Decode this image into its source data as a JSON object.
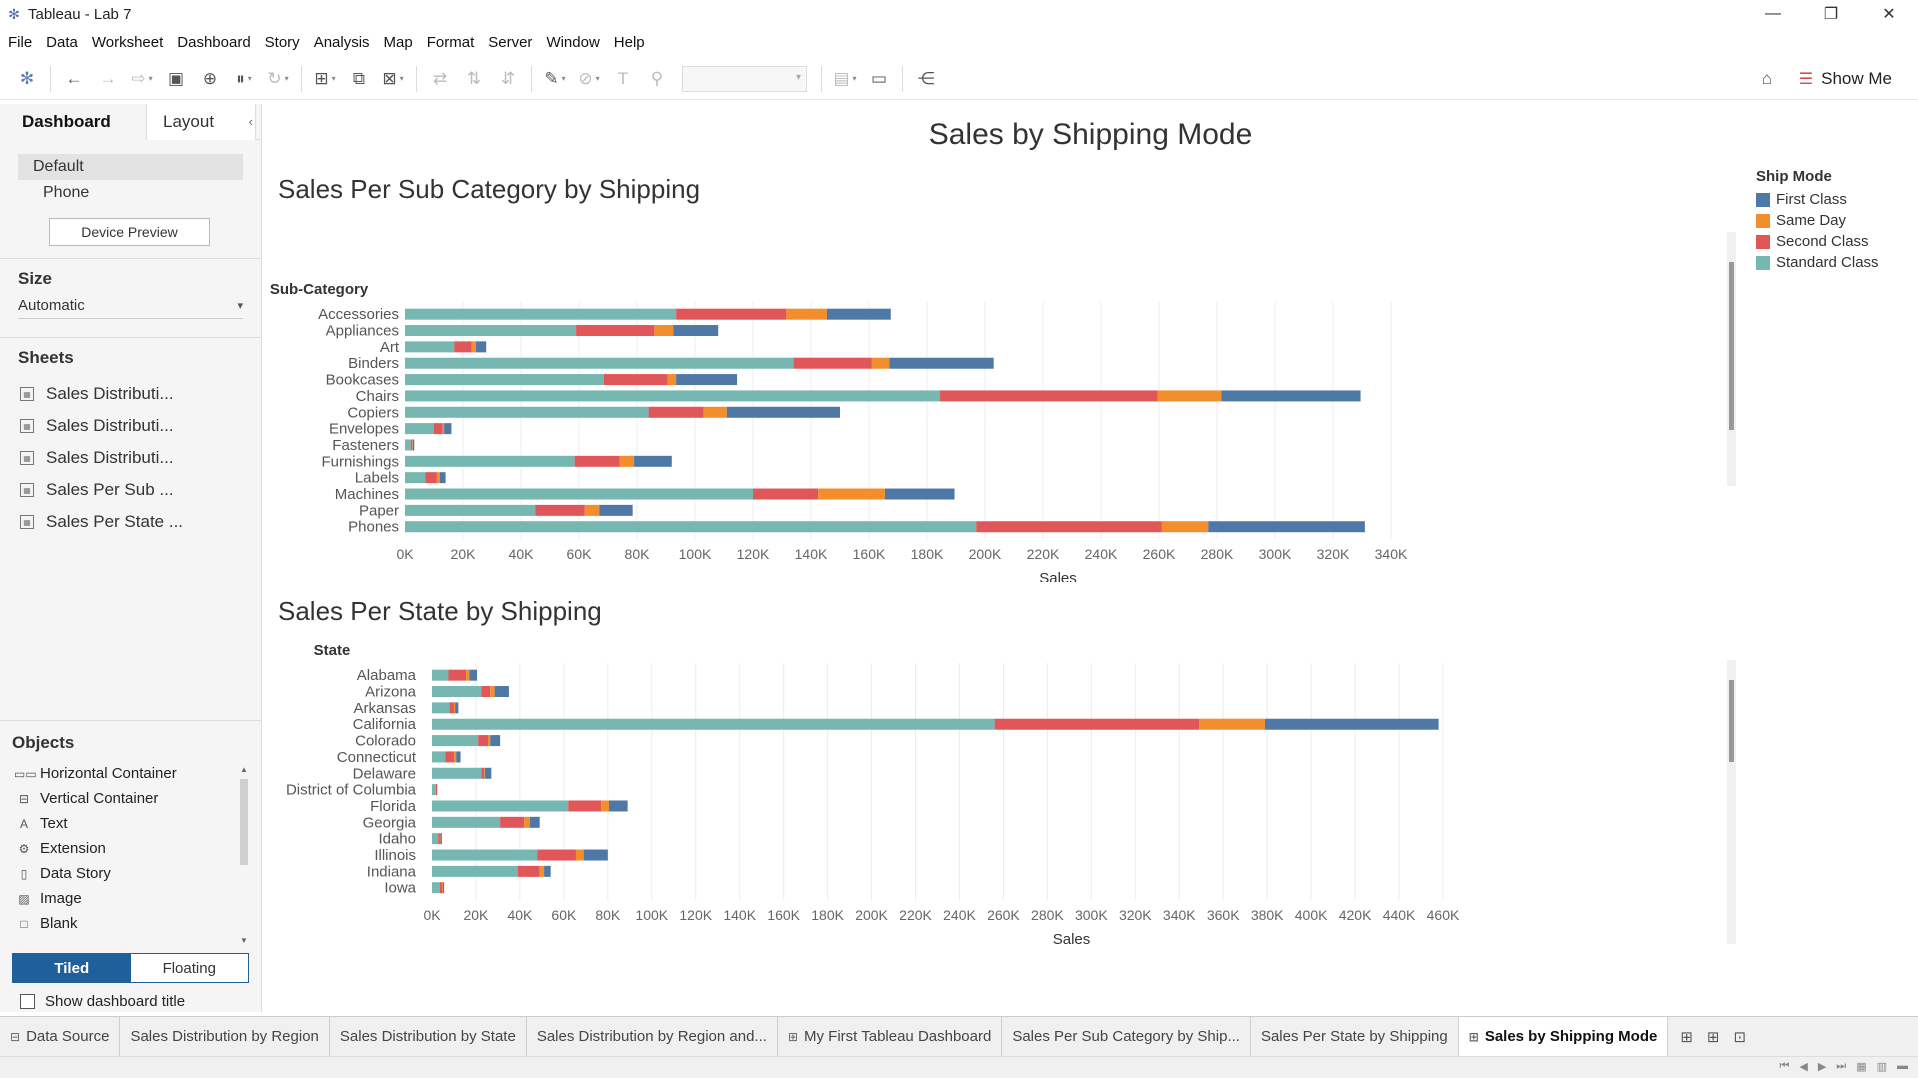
{
  "window": {
    "title": "Tableau - Lab 7"
  },
  "menu": [
    "File",
    "Data",
    "Worksheet",
    "Dashboard",
    "Story",
    "Analysis",
    "Map",
    "Format",
    "Server",
    "Window",
    "Help"
  ],
  "toolbar": {
    "show_me_label": "Show Me",
    "icons": [
      "tableau-logo-icon",
      "undo-icon",
      "redo-icon",
      "replay-icon",
      "save-icon",
      "new-data-source-icon",
      "pause-updates-icon",
      "refresh-icon",
      "new-worksheet-icon",
      "duplicate-icon",
      "clear-icon",
      "swap-icon",
      "sort-asc-icon",
      "sort-desc-icon",
      "highlight-icon",
      "group-icon",
      "label-icon",
      "pin-icon",
      "fit-combo",
      "show-cards-icon",
      "presentation-icon",
      "share-icon"
    ]
  },
  "left_panel": {
    "tabs": {
      "dashboard": "Dashboard",
      "layout": "Layout"
    },
    "devices": {
      "default": "Default",
      "phone": "Phone",
      "preview_button": "Device Preview"
    },
    "size": {
      "title": "Size",
      "value": "Automatic"
    },
    "sheets": {
      "title": "Sheets",
      "items": [
        {
          "label": "Sales Distributi...",
          "icon": "worksheet-icon"
        },
        {
          "label": "Sales Distributi...",
          "icon": "worksheet-icon"
        },
        {
          "label": "Sales Distributi...",
          "icon": "worksheet-icon"
        },
        {
          "label": "Sales Per Sub ...",
          "icon": "worksheet-check-icon"
        },
        {
          "label": "Sales Per State ...",
          "icon": "worksheet-check-icon"
        }
      ]
    },
    "objects": {
      "title": "Objects",
      "items": [
        {
          "label": "Horizontal Container",
          "icon": "horizontal-container-icon",
          "glyph": "▭▭"
        },
        {
          "label": "Vertical Container",
          "icon": "vertical-container-icon",
          "glyph": "⊟"
        },
        {
          "label": "Text",
          "icon": "text-icon",
          "glyph": "A"
        },
        {
          "label": "Extension",
          "icon": "extension-icon",
          "glyph": "⚙"
        },
        {
          "label": "Data Story",
          "icon": "data-story-icon",
          "glyph": "▯"
        },
        {
          "label": "Image",
          "icon": "image-icon",
          "glyph": "▨"
        },
        {
          "label": "Blank",
          "icon": "blank-icon",
          "glyph": "□"
        }
      ],
      "tiled_label": "Tiled",
      "floating_label": "Floating",
      "show_title_label": "Show dashboard title"
    }
  },
  "dashboard": {
    "title": "Sales by Shipping Mode",
    "legend": {
      "title": "Ship Mode",
      "items": [
        {
          "label": "First Class",
          "color": "#4e79a7"
        },
        {
          "label": "Same Day",
          "color": "#f28e2b"
        },
        {
          "label": "Second Class",
          "color": "#e15759"
        },
        {
          "label": "Standard Class",
          "color": "#76b7b2"
        }
      ]
    }
  },
  "chart_data": [
    {
      "type": "bar",
      "orientation": "horizontal",
      "stacked": true,
      "title": "Sales Per Sub Category by Shipping",
      "category_header": "Sub-Category",
      "xlabel": "Sales",
      "xlim": [
        0,
        340000
      ],
      "x_ticks": [
        "0K",
        "20K",
        "40K",
        "60K",
        "80K",
        "100K",
        "120K",
        "140K",
        "160K",
        "180K",
        "200K",
        "220K",
        "240K",
        "260K",
        "280K",
        "300K",
        "320K",
        "340K"
      ],
      "x_tick_values": [
        0,
        20000,
        40000,
        60000,
        80000,
        100000,
        120000,
        140000,
        160000,
        180000,
        200000,
        220000,
        240000,
        260000,
        280000,
        300000,
        320000,
        340000
      ],
      "categories": [
        "Accessories",
        "Appliances",
        "Art",
        "Binders",
        "Bookcases",
        "Chairs",
        "Copiers",
        "Envelopes",
        "Fasteners",
        "Furnishings",
        "Labels",
        "Machines",
        "Paper",
        "Phones"
      ],
      "series": [
        {
          "name": "Standard Class",
          "color": "#76b7b2",
          "values": [
            93500,
            59000,
            17000,
            134000,
            68500,
            184500,
            84000,
            10000,
            2000,
            58500,
            7000,
            120000,
            45000,
            197000
          ]
        },
        {
          "name": "Second Class",
          "color": "#e15759",
          "values": [
            38000,
            27000,
            6000,
            27000,
            22000,
            75000,
            19000,
            3000,
            500,
            15500,
            4000,
            22500,
            17000,
            64000
          ]
        },
        {
          "name": "Same Day",
          "color": "#f28e2b",
          "values": [
            14000,
            6500,
            1500,
            6000,
            3000,
            22000,
            8000,
            500,
            200,
            5000,
            1000,
            23000,
            5000,
            16000
          ]
        },
        {
          "name": "First Class",
          "color": "#4e79a7",
          "values": [
            22000,
            15500,
            3500,
            36000,
            21000,
            48000,
            39000,
            2500,
            500,
            13000,
            2000,
            24000,
            11500,
            54000
          ]
        }
      ]
    },
    {
      "type": "bar",
      "orientation": "horizontal",
      "stacked": true,
      "title": "Sales Per State by Shipping",
      "category_header": "State",
      "xlabel": "Sales",
      "xlim": [
        0,
        460000
      ],
      "x_ticks": [
        "0K",
        "20K",
        "40K",
        "60K",
        "80K",
        "100K",
        "120K",
        "140K",
        "160K",
        "180K",
        "200K",
        "220K",
        "240K",
        "260K",
        "280K",
        "300K",
        "320K",
        "340K",
        "360K",
        "380K",
        "400K",
        "420K",
        "440K",
        "460K"
      ],
      "x_tick_values": [
        0,
        20000,
        40000,
        60000,
        80000,
        100000,
        120000,
        140000,
        160000,
        180000,
        200000,
        220000,
        240000,
        260000,
        280000,
        300000,
        320000,
        340000,
        360000,
        380000,
        400000,
        420000,
        440000,
        460000
      ],
      "categories": [
        "Alabama",
        "Arizona",
        "Arkansas",
        "California",
        "Colorado",
        "Connecticut",
        "Delaware",
        "District of Columbia",
        "Florida",
        "Georgia",
        "Idaho",
        "Illinois",
        "Indiana",
        "Iowa"
      ],
      "series": [
        {
          "name": "Standard Class",
          "color": "#76b7b2",
          "values": [
            7500,
            22500,
            8000,
            256000,
            21000,
            6000,
            22500,
            1800,
            62000,
            31000,
            2800,
            48000,
            39000,
            3500
          ]
        },
        {
          "name": "Second Class",
          "color": "#e15759",
          "values": [
            8000,
            4000,
            2000,
            93000,
            4500,
            4000,
            1200,
            600,
            15000,
            11000,
            800,
            17500,
            10000,
            1200
          ]
        },
        {
          "name": "Same Day",
          "color": "#f28e2b",
          "values": [
            1500,
            2000,
            500,
            30000,
            1000,
            1000,
            300,
            0,
            3500,
            2500,
            300,
            3500,
            2000,
            300
          ]
        },
        {
          "name": "First Class",
          "color": "#4e79a7",
          "values": [
            3500,
            6500,
            1500,
            79000,
            4500,
            2000,
            3000,
            0,
            8500,
            4500,
            600,
            11000,
            3000,
            500
          ]
        }
      ]
    }
  ],
  "sheet_tabs": [
    {
      "label": "Data Source",
      "icon": "data-source-icon",
      "glyph": "⊟",
      "active": false
    },
    {
      "label": "Sales Distribution by Region",
      "icon": "",
      "glyph": "",
      "active": false
    },
    {
      "label": "Sales Distribution by State",
      "icon": "",
      "glyph": "",
      "active": false
    },
    {
      "label": "Sales Distribution by Region and...",
      "icon": "",
      "glyph": "",
      "active": false
    },
    {
      "label": "My First Tableau Dashboard",
      "icon": "dashboard-icon",
      "glyph": "⊞",
      "active": false
    },
    {
      "label": "Sales Per Sub Category by Ship...",
      "icon": "",
      "glyph": "",
      "active": false
    },
    {
      "label": "Sales Per State by Shipping",
      "icon": "",
      "glyph": "",
      "active": false
    },
    {
      "label": "Sales by Shipping Mode",
      "icon": "dashboard-icon",
      "glyph": "⊞",
      "active": true
    }
  ]
}
